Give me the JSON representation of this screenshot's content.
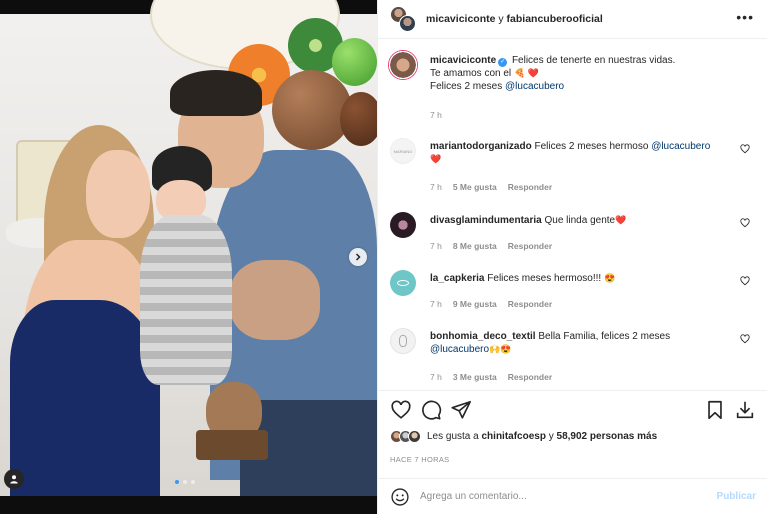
{
  "header": {
    "user1": "micaviciconte",
    "joiner": "y",
    "user2": "fabiancuberooficial",
    "more_icon": "more-horizontal-icon"
  },
  "caption": {
    "username": "micaviciconte",
    "line1": "Felices de tenerte en nuestras vidas.",
    "line2": "Te amamos con el",
    "line2_emoji": "🍕 ❤️",
    "line3": "Felices 2 meses",
    "mention": "@lucacubero",
    "time": "7 h"
  },
  "comments": [
    {
      "username": "mariantodorganizado",
      "text": "Felices 2 meses hermoso",
      "mention": "@lucacubero",
      "emoji": "❤️",
      "time": "7 h",
      "likes": "5 Me gusta",
      "reply": "Responder",
      "avatar_color": "#f4f4f4",
      "avatar_text": "MARIANO"
    },
    {
      "username": "divasglamindumentaria",
      "text": "Que linda gente",
      "mention": "",
      "emoji": "❤️",
      "time": "7 h",
      "likes": "8 Me gusta",
      "reply": "Responder",
      "avatar_color": "#2a1a24",
      "avatar_text": ""
    },
    {
      "username": "la_capkeria",
      "text": "Felices meses hermoso!!!",
      "mention": "",
      "emoji": "😍",
      "time": "7 h",
      "likes": "9 Me gusta",
      "reply": "Responder",
      "avatar_color": "#6fc6c6",
      "avatar_text": ""
    },
    {
      "username": "bonhomia_deco_textil",
      "text": "Bella Familia, felices 2 meses",
      "mention": "@lucacubero",
      "emoji": "🙌😍",
      "time": "7 h",
      "likes": "3 Me gusta",
      "reply": "Responder",
      "avatar_color": "#f2f2f2",
      "avatar_text": ""
    }
  ],
  "likes": {
    "prefix": "Les gusta a",
    "user": "chinitafcoesp",
    "joiner": "y",
    "count": "58,902 personas más"
  },
  "timestamp": "HACE 7 HORAS",
  "composer": {
    "placeholder": "Agrega un comentario...",
    "post_label": "Publicar"
  },
  "carousel": {
    "slide_count": 3,
    "active_index": 0
  },
  "colors": {
    "link": "#00376b",
    "verified": "#3897f0",
    "muted": "#8e8e8e",
    "post_disabled": "#b3dbff"
  }
}
